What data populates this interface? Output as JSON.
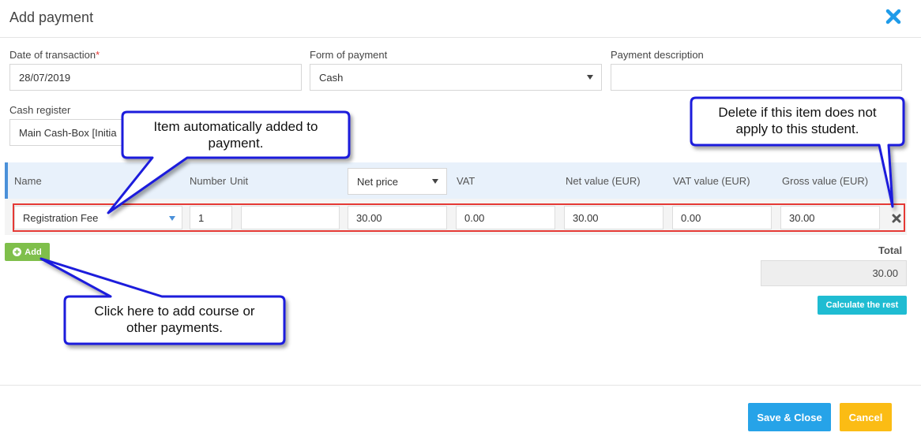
{
  "dialog": {
    "title": "Add payment"
  },
  "fields": {
    "date_label": "Date of transaction",
    "date_required": "*",
    "date_value": "28/07/2019",
    "form_label": "Form of payment",
    "form_value": "Cash",
    "desc_label": "Payment description",
    "desc_value": "",
    "cash_label": "Cash register",
    "cash_value": "Main Cash-Box [Initia"
  },
  "table": {
    "headers": {
      "name": "Name",
      "number": "Number",
      "unit": "Unit",
      "price_select": "Net price",
      "vat": "VAT",
      "net_value": "Net value (EUR)",
      "vat_value": "VAT value (EUR)",
      "gross_value": "Gross value (EUR)"
    },
    "row": {
      "name": "Registration Fee",
      "number": "1",
      "unit": "",
      "net_price": "30.00",
      "vat": "0.00",
      "net_value": "30.00",
      "vat_value": "0.00",
      "gross_value": "30.00"
    }
  },
  "actions": {
    "add_label": "Add",
    "total_label": "Total",
    "total_value": "30.00",
    "calc_label": "Calculate the rest",
    "save_label": "Save & Close",
    "cancel_label": "Cancel"
  },
  "callouts": {
    "auto_added_l1": "Item automatically added to",
    "auto_added_l2": "payment.",
    "delete_l1": "Delete if this item does not",
    "delete_l2": "apply to this student.",
    "add_hint_l1": "Click here to add course or",
    "add_hint_l2": "other payments."
  },
  "colors": {
    "close": "#1e9be9",
    "callout_border": "#1a1adc",
    "highlight": "#e53935",
    "add_button": "#7fbf4b",
    "calc_button": "#1fbcd2",
    "save_button": "#26a3e8",
    "cancel_button": "#fbbc14"
  }
}
